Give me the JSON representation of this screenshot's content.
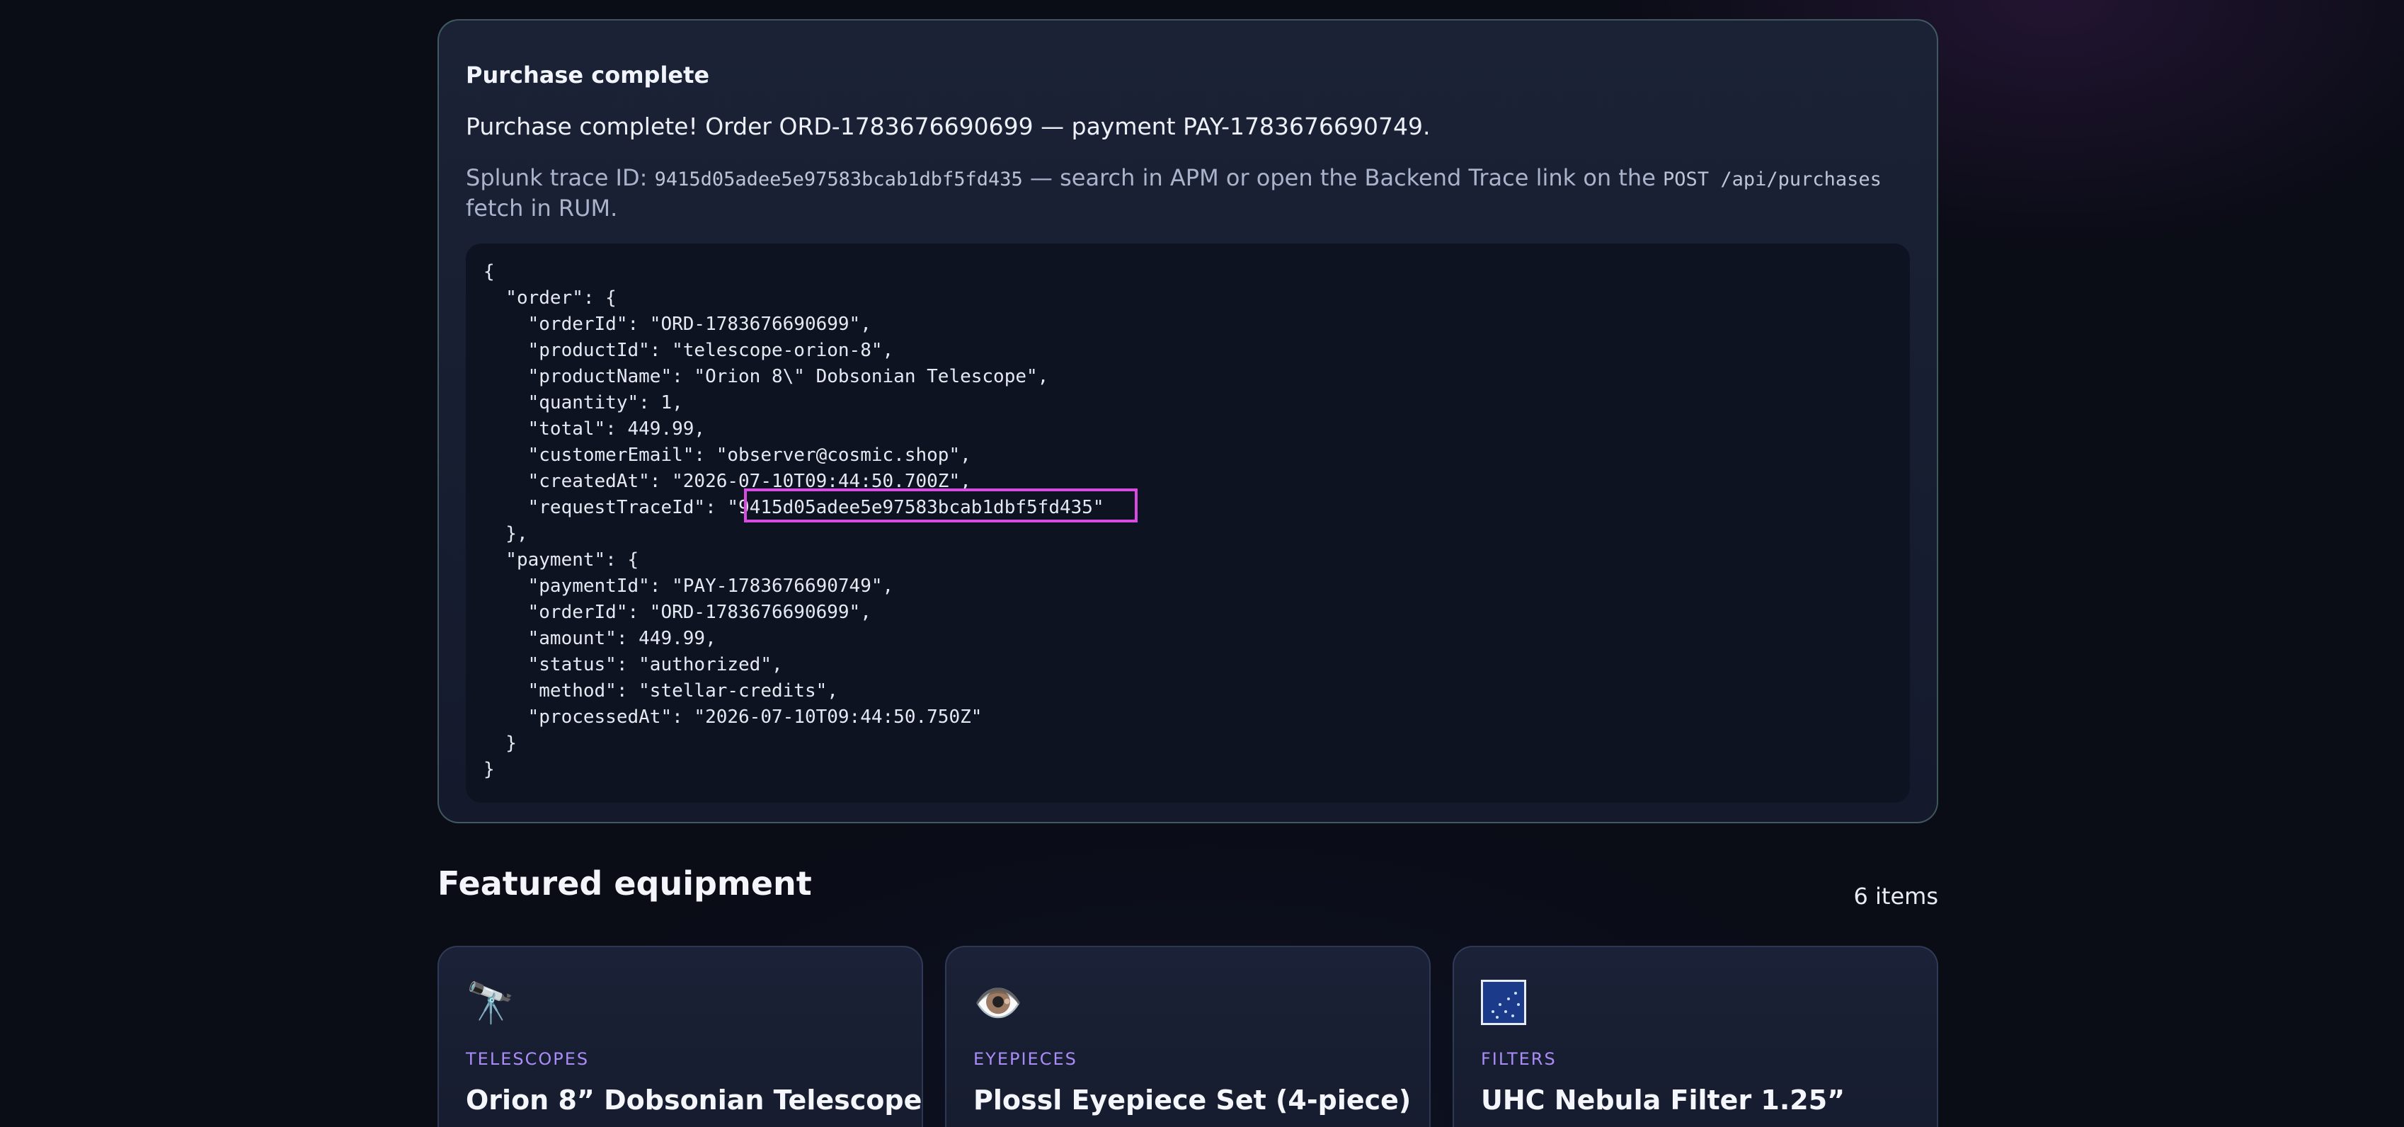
{
  "purchase": {
    "title": "Purchase complete",
    "message": "Purchase complete! Order ORD-1783676690699 — payment PAY-1783676690749.",
    "trace_prefix": "Splunk trace ID: ",
    "trace_id": "9415d05adee5e97583bcab1dbf5fd435",
    "trace_mid": " — search in APM or open the Backend Trace link on the ",
    "trace_endpoint": "POST /api/purchases",
    "trace_suffix": " fetch in RUM.",
    "json_lines": [
      "{",
      "  \"order\": {",
      "    \"orderId\": \"ORD-1783676690699\",",
      "    \"productId\": \"telescope-orion-8\",",
      "    \"productName\": \"Orion 8\\\" Dobsonian Telescope\",",
      "    \"quantity\": 1,",
      "    \"total\": 449.99,",
      "    \"customerEmail\": \"observer@cosmic.shop\",",
      "    \"createdAt\": \"2026-07-10T09:44:50.700Z\",",
      "    \"requestTraceId\": \"9415d05adee5e97583bcab1dbf5fd435\"",
      "  },",
      "  \"payment\": {",
      "    \"paymentId\": \"PAY-1783676690749\",",
      "    \"orderId\": \"ORD-1783676690699\",",
      "    \"amount\": 449.99,",
      "    \"status\": \"authorized\",",
      "    \"method\": \"stellar-credits\",",
      "    \"processedAt\": \"2026-07-10T09:44:50.750Z\"",
      "  }",
      "}"
    ]
  },
  "featured": {
    "title": "Featured equipment",
    "count": "6 items",
    "cards": [
      {
        "icon": "🔭",
        "icon_name": "telescope-icon",
        "category": "TELESCOPES",
        "name": "Orion 8” Dobsonian Telescope"
      },
      {
        "icon": "👁️",
        "icon_name": "eye-icon",
        "category": "EYEPIECES",
        "name": "Plossl Eyepiece Set (4-piece)"
      },
      {
        "icon": "",
        "icon_name": "nebula-image-icon",
        "category": "FILTERS",
        "name": "UHC Nebula Filter 1.25”"
      }
    ]
  },
  "colors": {
    "accent_category": "#a98cf5",
    "highlight_border": "#d84be0",
    "panel_border": "#6ea096"
  }
}
